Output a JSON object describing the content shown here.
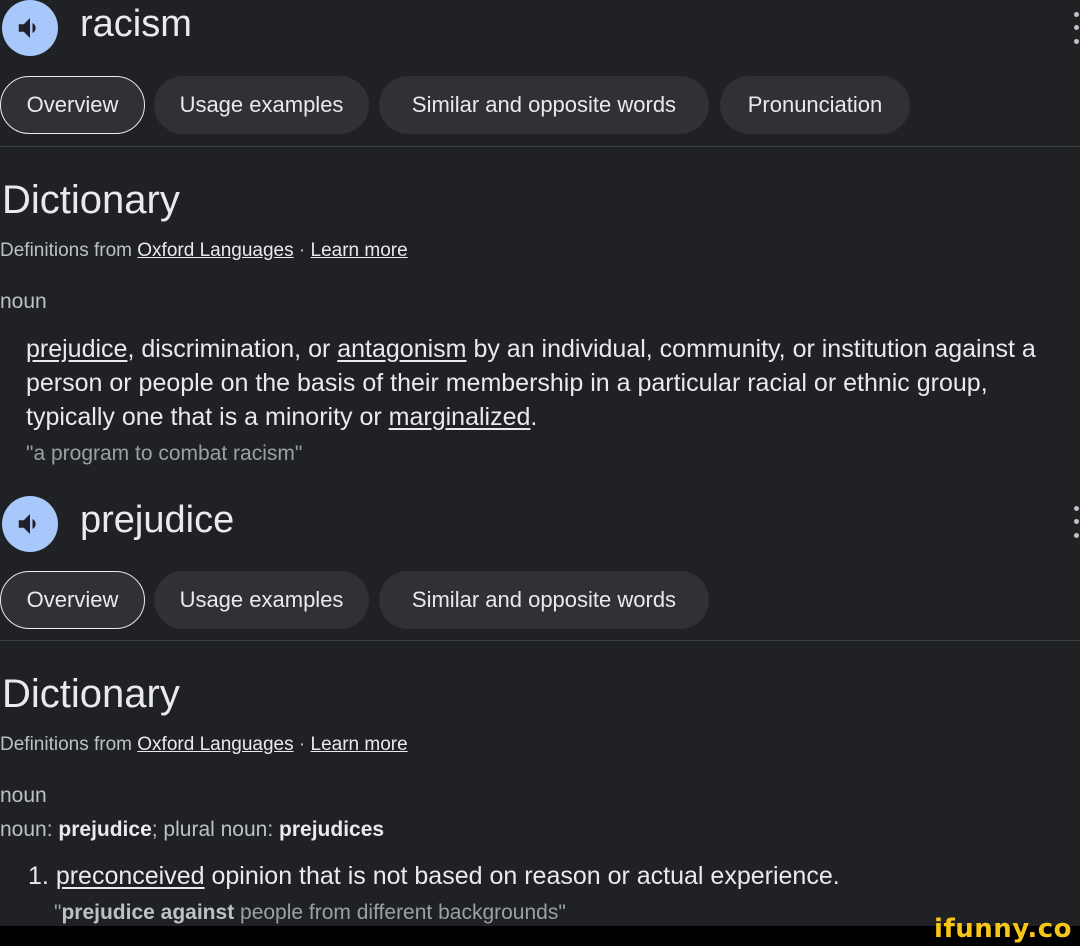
{
  "entry1": {
    "word": "racism",
    "tabs": [
      "Overview",
      "Usage examples",
      "Similar and opposite words",
      "Pronunciation"
    ],
    "section": "Dictionary",
    "source_prefix": "Definitions from",
    "source_link": "Oxford Languages",
    "source_sep": "·",
    "learn_more": "Learn more",
    "pos": "noun",
    "definition": {
      "w1": "prejudice",
      "t1": ", discrimination, or ",
      "w2": "antagonism",
      "t2": " by an individual, community, or institution against a person or people on the basis of their membership in a particular racial or ethnic group, typically one that is a minority or ",
      "w3": "marginalized",
      "t3": "."
    },
    "example": "\"a program to combat racism\""
  },
  "entry2": {
    "word": "prejudice",
    "tabs": [
      "Overview",
      "Usage examples",
      "Similar and opposite words"
    ],
    "section": "Dictionary",
    "source_prefix": "Definitions from",
    "source_link": "Oxford Languages",
    "source_sep": "·",
    "learn_more": "Learn more",
    "pos": "noun",
    "forms": {
      "label1": "noun: ",
      "form1": "prejudice",
      "label2": "; plural noun: ",
      "form2": "prejudices"
    },
    "sense_number": "1.",
    "definition": {
      "w1": "preconceived",
      "t1": " opinion that is not based on reason or actual experience."
    },
    "example": {
      "open": "\"",
      "bold": "prejudice against",
      "rest": " people from different backgrounds\""
    }
  },
  "watermark": "ifunny.co",
  "colors": {
    "background": "#202124",
    "chip": "#303134",
    "speaker": "#a8c7fa",
    "watermark": "#f5c518"
  }
}
